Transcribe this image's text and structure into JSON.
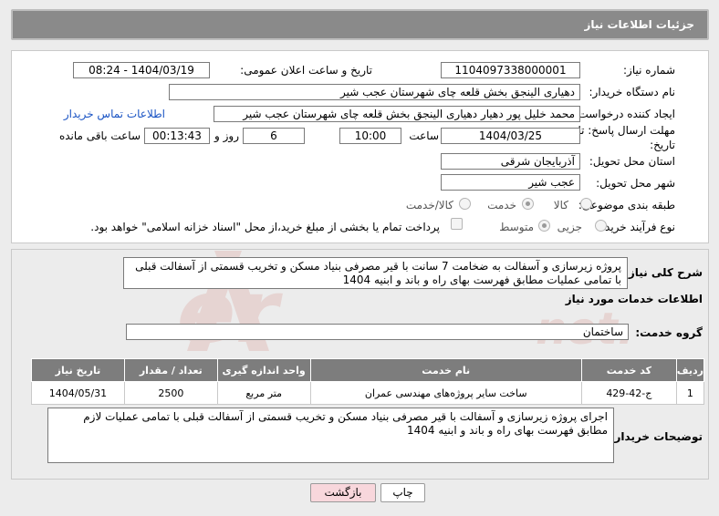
{
  "header": {
    "title": "جزئیات اطلاعات نیاز"
  },
  "form": {
    "need_number_label": "شماره نیاز:",
    "need_number": "1104097338000001",
    "announce_label": "تاریخ و ساعت اعلان عمومی:",
    "announce_value": "1404/03/19 - 08:24",
    "buyer_org_label": "نام دستگاه خریدار:",
    "buyer_org": "دهیاری الینجق بخش قلعه چای شهرستان عجب شیر",
    "requester_label": "ایجاد کننده درخواست:",
    "requester": "محمد خلیل پور دهیار دهیاری الینجق بخش قلعه چای شهرستان عجب شیر",
    "buyer_contact_link": "اطلاعات تماس خریدار",
    "deadline_label_1": "مهلت ارسال پاسخ: تا",
    "deadline_label_2": "تاریخ:",
    "deadline_date": "1404/03/25",
    "time_label": "ساعت",
    "deadline_time": "10:00",
    "days_value": "6",
    "days_label": "روز و",
    "remaining_time": "00:13:43",
    "remaining_label": "ساعت باقی مانده",
    "province_label": "استان محل تحویل:",
    "province": "آذربایجان شرقی",
    "city_label": "شهر محل تحویل:",
    "city": "عجب شیر",
    "category_label": "طبقه بندی موضوعی:",
    "category_options": [
      "کالا",
      "خدمت",
      "کالا/خدمت"
    ],
    "category_selected": "خدمت",
    "process_label": "نوع فرآیند خرید :",
    "process_options": [
      "جزیی",
      "متوسط"
    ],
    "process_selected": "متوسط",
    "payment_note": "پرداخت تمام یا بخشی از مبلغ خرید،از محل \"اسناد خزانه اسلامی\" خواهد بود."
  },
  "description": {
    "label": "شرح کلی نیاز:",
    "text": "پروژه زیرسازی و آسفالت به ضخامت 7 سانت با قیر مصرفی بنیاد مسکن و تخریب قسمتی از آسفالت قبلی با تمامی عملیات مطابق فهرست بهای راه و باند و ابنیه 1404"
  },
  "services": {
    "section_title": "اطلاعات خدمات مورد نیاز",
    "group_label": "گروه خدمت:",
    "group_value": "ساختمان",
    "columns": [
      "ردیف",
      "کد خدمت",
      "نام خدمت",
      "واحد اندازه گیری",
      "تعداد / مقدار",
      "تاریخ نیاز"
    ],
    "rows": [
      [
        "1",
        "ج-42-429",
        "ساخت سایر پروژه‌های مهندسی عمران",
        "متر مربع",
        "2500",
        "1404/05/31"
      ]
    ]
  },
  "buyer_notes": {
    "label": "توضیحات خریدار:",
    "text": "اجرای پروژه زیرسازی و آسفالت با قیر مصرفی بنیاد مسکن و تخریب قسمتی از آسفالت قبلی با تمامی عملیات لازم مطابق فهرست بهای راه و باند و ابنیه 1404"
  },
  "buttons": {
    "print": "چاپ",
    "back": "بازگشت"
  },
  "colors": {
    "header_bg": "#8a8a8a",
    "link": "#1a54c4",
    "back_button_bg": "#f8d7dc",
    "watermark": "#c0392b"
  }
}
